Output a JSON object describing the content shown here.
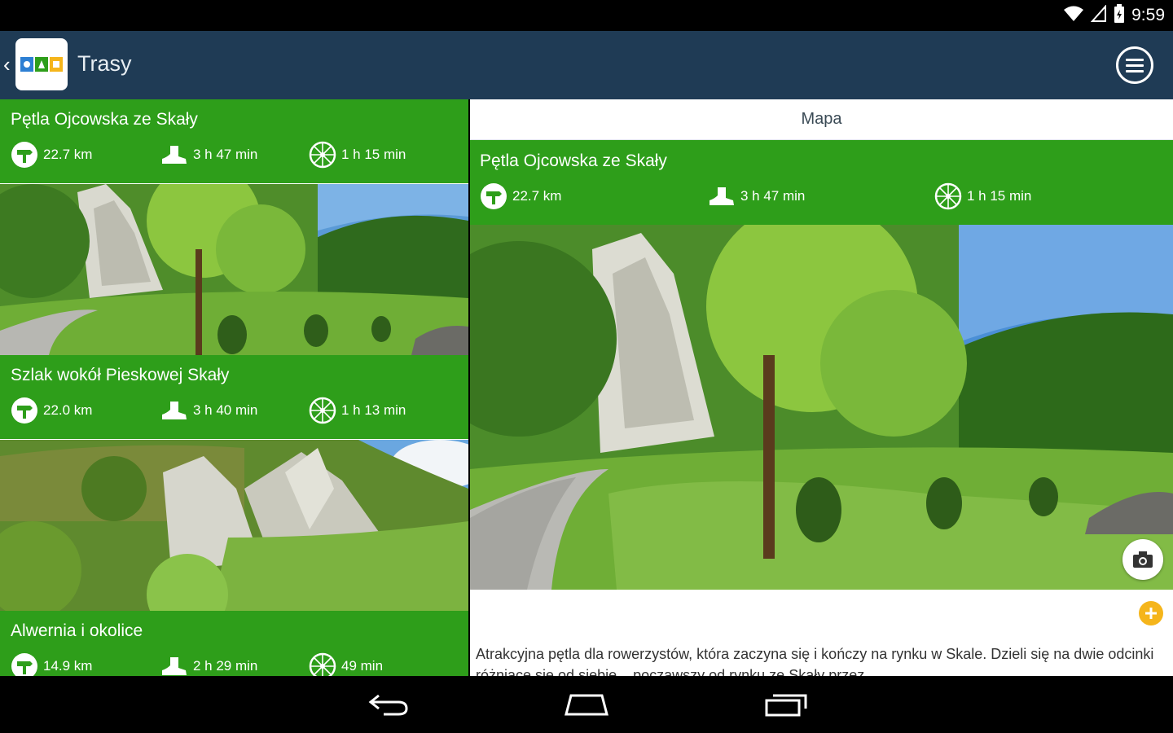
{
  "status_bar": {
    "time": "9:59"
  },
  "app_bar": {
    "title": "Trasy",
    "back_icon": "chevron-left-icon",
    "menu_icon": "menu-icon"
  },
  "routes": [
    {
      "name": "Pętla Ojcowska ze Skały",
      "distance": "22.7 km",
      "walk_time": "3 h 47 min",
      "bike_time": "1 h 15 min"
    },
    {
      "name": "Szlak wokół Pieskowej Skały",
      "distance": "22.0 km",
      "walk_time": "3 h 40 min",
      "bike_time": "1 h 13 min"
    },
    {
      "name": "Alwernia i okolice",
      "distance": "14.9 km",
      "walk_time": "2 h 29 min",
      "bike_time": "49 min"
    }
  ],
  "detail": {
    "tab_label": "Mapa",
    "name": "Pętla Ojcowska ze Skały",
    "distance": "22.7 km",
    "walk_time": "3 h 47 min",
    "bike_time": "1 h 15 min",
    "description": "Atrakcyjna pętla dla rowerzystów, która zaczyna się i kończy na rynku w Skale. Dzieli się na dwie odcinki różniące się od siebie... począwszy od rynku ze Skały przez"
  },
  "colors": {
    "app_bar": "#1f3b55",
    "route_green": "#2e9e1a",
    "accent_yellow": "#f5b51b"
  }
}
